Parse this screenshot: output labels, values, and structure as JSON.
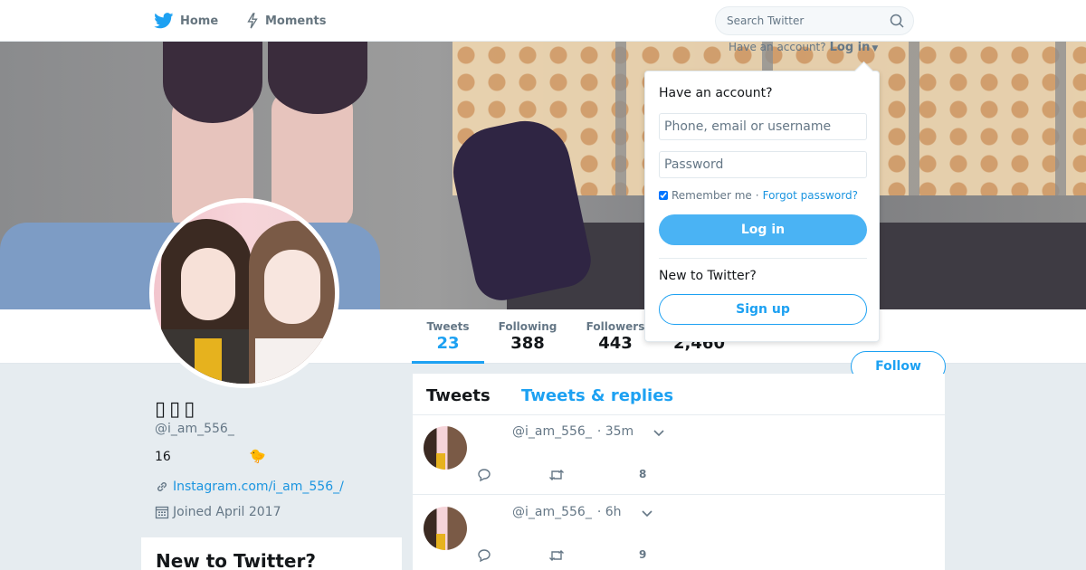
{
  "nav": {
    "home_label": "Home",
    "moments_label": "Moments",
    "search_placeholder": "Search Twitter"
  },
  "login_toggle": {
    "prompt": "Have an account?",
    "action": "Log in"
  },
  "login_box": {
    "title": "Have an account?",
    "username_placeholder": "Phone, email or username",
    "password_placeholder": "Password",
    "remember_label": "Remember me",
    "separator": "·",
    "forgot_label": "Forgot password?",
    "login_button": "Log in",
    "new_label": "New to Twitter?",
    "signup_button": "Sign up"
  },
  "stats": {
    "tweets": {
      "label": "Tweets",
      "value": "23"
    },
    "following": {
      "label": "Following",
      "value": "388"
    },
    "followers": {
      "label": "Followers",
      "value": "443"
    },
    "likes": {
      "value": "2,460"
    }
  },
  "follow_button": "Follow",
  "profile": {
    "name": "▯▯▯",
    "handle": "@i_am_556_",
    "bio": "16",
    "bio_emoji": "🐤",
    "link": "Instagram.com/i_am_556_/",
    "joined": "Joined April 2017"
  },
  "new_card": {
    "title": "New to Twitter?"
  },
  "timeline": {
    "tabs": [
      "Tweets",
      "Tweets & replies"
    ],
    "tweets": [
      {
        "handle": "@i_am_556_",
        "time": "· 35m",
        "likes": "8"
      },
      {
        "handle": "@i_am_556_",
        "time": "· 6h",
        "likes": "9"
      }
    ]
  },
  "colors": {
    "accent": "#1da1f2",
    "background": "#e6ecf0"
  }
}
